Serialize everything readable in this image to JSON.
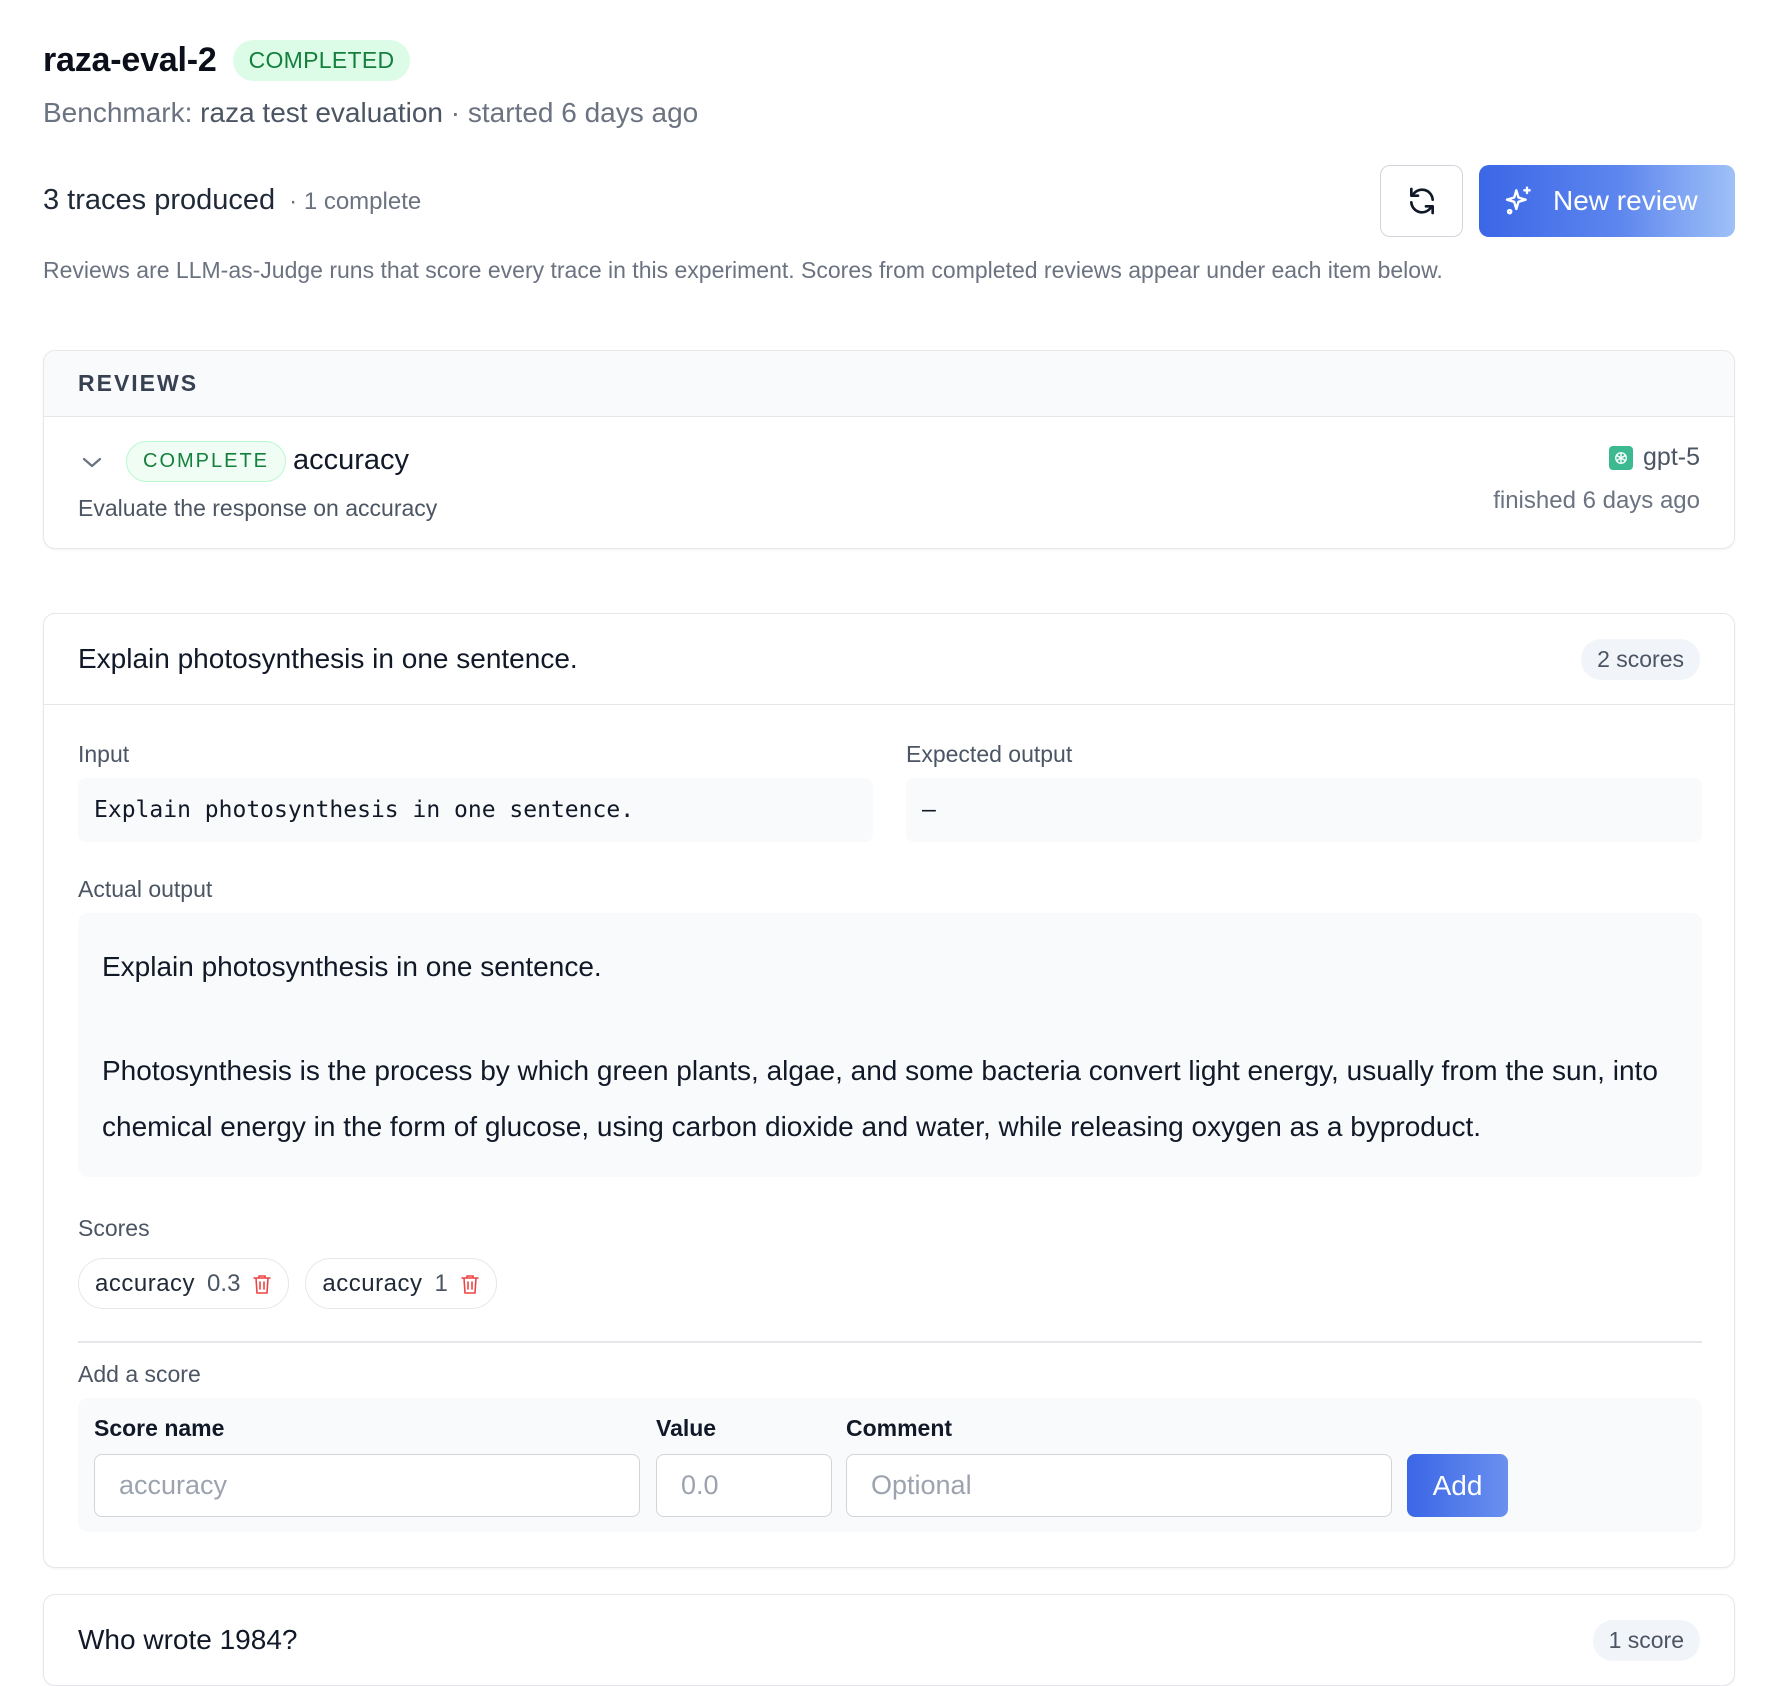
{
  "header": {
    "title": "raza-eval-2",
    "status": "COMPLETED",
    "benchmark_prefix": "Benchmark: ",
    "benchmark_name": "raza test evaluation",
    "started": " · started 6 days ago"
  },
  "summary": {
    "traces": "3 traces produced",
    "complete": "· 1 complete",
    "new_review_label": "New review",
    "description": "Reviews are LLM-as-Judge runs that score every trace in this experiment. Scores from completed reviews appear under each item below."
  },
  "reviews": {
    "heading": "REVIEWS",
    "items": [
      {
        "status": "COMPLETE",
        "name": "accuracy",
        "description": "Evaluate the response on accuracy",
        "model": "gpt-5",
        "finished": "finished 6 days ago"
      }
    ]
  },
  "items": [
    {
      "question": "Explain photosynthesis in one sentence.",
      "score_count": "2 scores",
      "input_label": "Input",
      "input": "Explain photosynthesis in one sentence.",
      "expected_label": "Expected output",
      "expected": "—",
      "actual_label": "Actual output",
      "actual_line1": "Explain photosynthesis in one sentence.",
      "actual_line2": "Photosynthesis is the process by which green plants, algae, and some bacteria convert light energy, usually from the sun, into chemical energy in the form of glucose, using carbon dioxide and water, while releasing oxygen as a byproduct.",
      "scores_label": "Scores",
      "scores": [
        {
          "name": "accuracy",
          "value": "0.3"
        },
        {
          "name": "accuracy",
          "value": "1"
        }
      ],
      "add_score": {
        "heading": "Add a score",
        "name_label": "Score name",
        "name_placeholder": "accuracy",
        "value_label": "Value",
        "value_placeholder": "0.0",
        "comment_label": "Comment",
        "comment_placeholder": "Optional",
        "add_label": "Add"
      }
    },
    {
      "question": "Who wrote 1984?",
      "score_count": "1 score"
    }
  ],
  "colors": {
    "accent": "#3b66e6",
    "success": "#15803d",
    "danger": "#ef4444"
  }
}
